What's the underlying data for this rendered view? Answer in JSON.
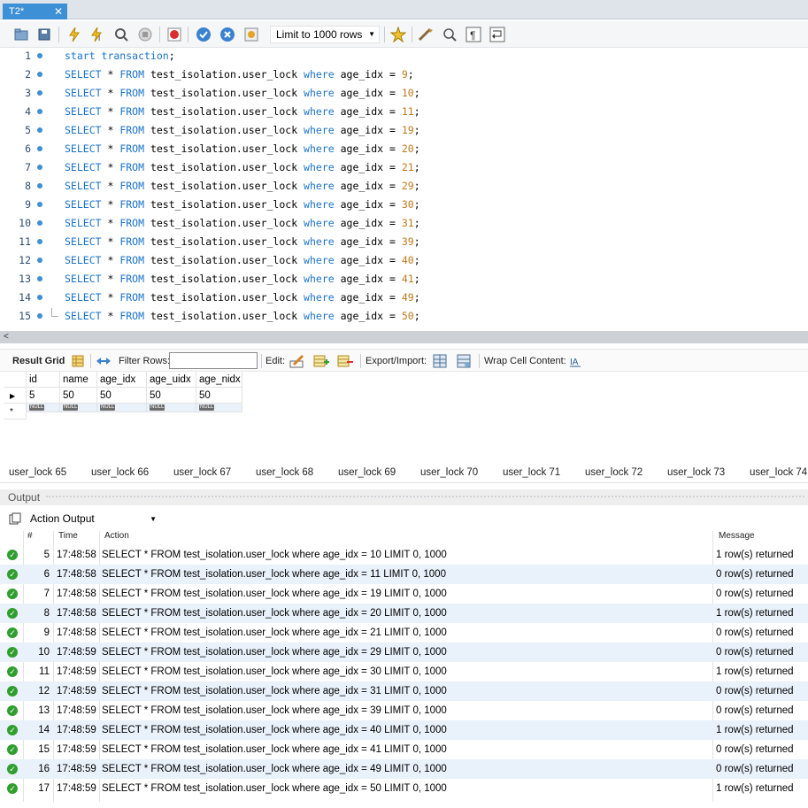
{
  "tab": {
    "title": "T2*",
    "close": "✕"
  },
  "toolbar": {
    "limit_label": "Limit to 1000 rows",
    "icons": [
      "open-file-icon",
      "save-icon",
      "execute-icon",
      "execute-current-icon",
      "explain-icon",
      "stop-icon",
      "toggle-error-icon",
      "commit-icon",
      "rollback-icon",
      "autocommit-icon",
      "beautify-icon",
      "find-icon",
      "invisible-chars-icon",
      "wrap-icon"
    ]
  },
  "editor": {
    "lines": [
      {
        "n": "1",
        "pre": "",
        "kw1": "start transaction",
        "rest": ";",
        "num": ""
      },
      {
        "n": "2",
        "num": "9"
      },
      {
        "n": "3",
        "num": "10"
      },
      {
        "n": "4",
        "num": "11"
      },
      {
        "n": "5",
        "num": "19"
      },
      {
        "n": "6",
        "num": "20"
      },
      {
        "n": "7",
        "num": "21"
      },
      {
        "n": "8",
        "num": "29"
      },
      {
        "n": "9",
        "num": "30"
      },
      {
        "n": "10",
        "num": "31"
      },
      {
        "n": "11",
        "num": "39"
      },
      {
        "n": "12",
        "num": "40"
      },
      {
        "n": "13",
        "num": "41"
      },
      {
        "n": "14",
        "num": "49"
      },
      {
        "n": "15",
        "num": "50"
      }
    ],
    "select_kw": "SELECT",
    "star": " * ",
    "from_kw": "FROM",
    "table": " test_isolation.user_lock ",
    "where_kw": "where",
    "cond": " age_idx = ",
    "semi": ";"
  },
  "result_toolbar": {
    "result_grid": "Result Grid",
    "filter_rows": "Filter Rows:",
    "edit": "Edit:",
    "export_import": "Export/Import:",
    "wrap_cell": "Wrap Cell Content:"
  },
  "grid": {
    "columns": [
      "id",
      "name",
      "age_idx",
      "age_uidx",
      "age_nidx"
    ],
    "row": [
      "5",
      "50",
      "50",
      "50",
      "50"
    ],
    "null_label": "NULL"
  },
  "result_tabs": [
    "user_lock 65",
    "user_lock 66",
    "user_lock 67",
    "user_lock 68",
    "user_lock 69",
    "user_lock 70",
    "user_lock 71",
    "user_lock 72",
    "user_lock 73",
    "user_lock 74"
  ],
  "output": {
    "header": "Output",
    "select_label": "Action Output",
    "columns": {
      "num": "#",
      "time": "Time",
      "action": "Action",
      "message": "Message"
    },
    "rows": [
      {
        "num": "5",
        "time": "17:48:58",
        "action": "SELECT * FROM test_isolation.user_lock where age_idx = 10 LIMIT 0, 1000",
        "message": "1 row(s) returned"
      },
      {
        "num": "6",
        "time": "17:48:58",
        "action": "SELECT * FROM test_isolation.user_lock where age_idx = 11 LIMIT 0, 1000",
        "message": "0 row(s) returned"
      },
      {
        "num": "7",
        "time": "17:48:58",
        "action": "SELECT * FROM test_isolation.user_lock where age_idx = 19 LIMIT 0, 1000",
        "message": "0 row(s) returned"
      },
      {
        "num": "8",
        "time": "17:48:58",
        "action": "SELECT * FROM test_isolation.user_lock where age_idx = 20 LIMIT 0, 1000",
        "message": "1 row(s) returned"
      },
      {
        "num": "9",
        "time": "17:48:58",
        "action": "SELECT * FROM test_isolation.user_lock where age_idx = 21 LIMIT 0, 1000",
        "message": "0 row(s) returned"
      },
      {
        "num": "10",
        "time": "17:48:59",
        "action": "SELECT * FROM test_isolation.user_lock where age_idx = 29 LIMIT 0, 1000",
        "message": "0 row(s) returned"
      },
      {
        "num": "11",
        "time": "17:48:59",
        "action": "SELECT * FROM test_isolation.user_lock where age_idx = 30 LIMIT 0, 1000",
        "message": "1 row(s) returned"
      },
      {
        "num": "12",
        "time": "17:48:59",
        "action": "SELECT * FROM test_isolation.user_lock where age_idx = 31 LIMIT 0, 1000",
        "message": "0 row(s) returned"
      },
      {
        "num": "13",
        "time": "17:48:59",
        "action": "SELECT * FROM test_isolation.user_lock where age_idx = 39 LIMIT 0, 1000",
        "message": "0 row(s) returned"
      },
      {
        "num": "14",
        "time": "17:48:59",
        "action": "SELECT * FROM test_isolation.user_lock where age_idx = 40 LIMIT 0, 1000",
        "message": "1 row(s) returned"
      },
      {
        "num": "15",
        "time": "17:48:59",
        "action": "SELECT * FROM test_isolation.user_lock where age_idx = 41 LIMIT 0, 1000",
        "message": "0 row(s) returned"
      },
      {
        "num": "16",
        "time": "17:48:59",
        "action": "SELECT * FROM test_isolation.user_lock where age_idx = 49 LIMIT 0, 1000",
        "message": "0 row(s) returned"
      },
      {
        "num": "17",
        "time": "17:48:59",
        "action": "SELECT * FROM test_isolation.user_lock where age_idx = 50 LIMIT 0, 1000",
        "message": "1 row(s) returned"
      }
    ]
  },
  "colors": {
    "accent": "#3d8fd6",
    "keyword": "#1a73c9",
    "number": "#c0781a",
    "ok": "#2f9e2f",
    "alt_row": "#e9f1fa"
  }
}
